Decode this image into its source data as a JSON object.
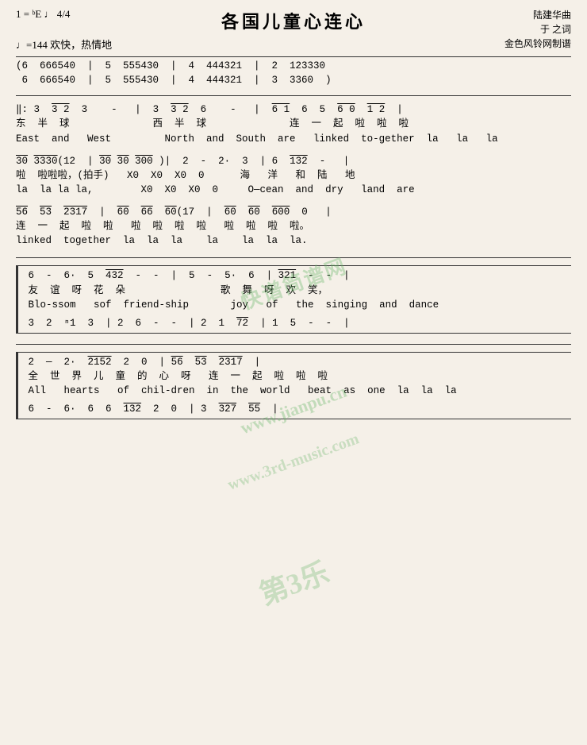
{
  "title": "各国儿童心连心",
  "key_signature": "1 = ᵇE  ♩",
  "time_signature": "4/4",
  "tempo": "♩=144 欢快，热情地",
  "composer": "陆建华曲",
  "lyricist": "于  之词",
  "source": "金色风铃网制谱",
  "watermarks": [
    "快谱简谱网",
    "www.jianpu.cn",
    "www.3rd-music.com",
    "第3乐"
  ],
  "lines": [
    {
      "notation": "(6  6̲6̲6̲5̲  4̲ 0̲  |  5  5̲5̲  5̲4̲3̲0̲  |  4  4̲4̲4̲3̲  2̲1̲  |  2  1̲2̲3̲3̲3̲0̲",
      "chinese": "",
      "english": ""
    },
    {
      "notation": " 6  6̲6̲6̲5̲  4̲ 0̲  |  5  5̲5̲  5̲4̲3̲0̲  |  4  4̲4̲4̲3̲  2̲1̲  |  3  3̲3̲6̲  0  )",
      "chinese": "",
      "english": ""
    },
    {
      "notation": "‖: 3  3̲2̲  3    -   |  3  3̲2̲  6    -   |  6̲1̲  6  5  6̲0̲  1̲ 2̲  |",
      "chinese": "东  半  球          西  半  球          连  一  起  啦  啦  啦",
      "english": "East and  West       North and South  are  linked to-gether la  la  la"
    },
    {
      "notation": "3̤0̤ 3̲3̲3̲3̲0̲(1̲2̲  | 3̲0̲ 3̲0̲ 3̲0̲0̲ )|  2  -  2·  3  | 6  1̲3̲2̲  -   |",
      "chinese": "啦  啦啦啦，(拍手)  X0  X0  X0  0      海   洋  和  陆  地",
      "english": "la  la la la ,      X0  X0  X0  0    O—cean and dry  land are"
    },
    {
      "notation": "5̲6̲  5̲3̲  2̲3̲1̲7̲  |  6̲0̲  6̲6̲  6̲0̲(1̲7̲  |  6̲0̲  6̲0̲  6̲0̲0̲  0   |",
      "chinese": "连  一  起  啦  啦  啦    啦  啦  啦  啦。",
      "english": "linked together la  la  la   la   la la la."
    }
  ],
  "section2": {
    "lines": [
      {
        "notation": "[ 6  -  6·  5̲  4̲3̲2̲  -   -   |  5  -  5·  6̲  | 3̲2̲1̲  -   -  |",
        "chinese": "友  谊  呀  花  朵           歌  舞  呀  欢  笑，",
        "english": "Blo-ssom  sof  friend-ship    joy   of  the singing and dance"
      },
      {
        "notation": "  3  2  ⁿ1̲  3  | 2  6  -   -   | 2  1  7̲ 2̲  | 1  5  -   -  |",
        "chinese": "",
        "english": ""
      }
    ]
  },
  "section3": {
    "lines": [
      {
        "notation": "[ 2  —  2·  2̲ 1̲5̲2̲  2  0̲  | 5̲6̲  5̲3̲  2̲3̲1̲7̲  |",
        "chinese": "全   世  界  儿  童  的  心  呀   连  一  起  啦  啦  啦",
        "english": "All   hearts  of  chil-dren in  the world  beat  as one la  la  la"
      },
      {
        "notation": "  6  -  6·  6̲  6  1̲3̲2̲  2  0̲  | 3  3̲2̲7̲  5̲5̲  |",
        "chinese": "",
        "english": ""
      }
    ]
  }
}
